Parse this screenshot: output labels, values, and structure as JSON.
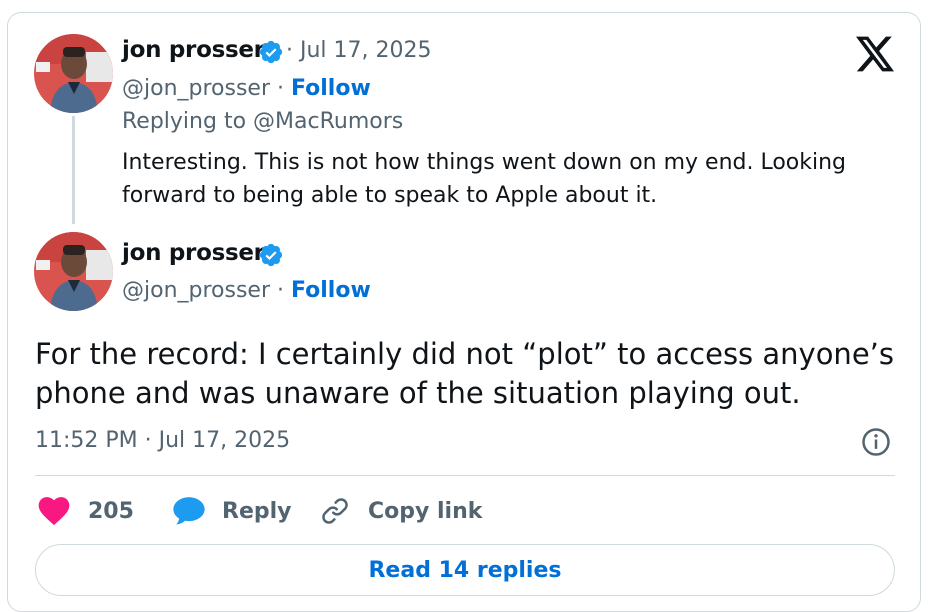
{
  "reply_tweet": {
    "author_name": "jon prosser",
    "date_sep": " · ",
    "date": "Jul 17, 2025",
    "handle": "@jon_prosser",
    "handle_sep": " · ",
    "follow_label": "Follow",
    "replying_to": "Replying to @MacRumors",
    "body": "Interesting. This is not how things went down on my end. Looking forward to being able to speak to Apple about it."
  },
  "main_tweet": {
    "author_name": "jon prosser",
    "handle": "@jon_prosser",
    "handle_sep": " · ",
    "follow_label": "Follow",
    "body": "For the record: I certainly did not “plot” to access anyone’s phone and was unaware of the situation playing out.",
    "timestamp": "11:52 PM · Jul 17, 2025"
  },
  "actions": {
    "like_count": "205",
    "reply_label": "Reply",
    "copy_link_label": "Copy link"
  },
  "read_replies_label": "Read 14 replies",
  "icons": {
    "brand": "x-logo-icon",
    "verified": "verified-badge-icon",
    "info": "info-icon",
    "like": "heart-icon",
    "reply": "speech-bubble-icon",
    "copy": "link-icon"
  },
  "colors": {
    "text": "#0f1419",
    "muted": "#536471",
    "link": "#006fd6",
    "verified": "#1d9bf0",
    "like": "#f91880",
    "border": "#cfd9de"
  }
}
